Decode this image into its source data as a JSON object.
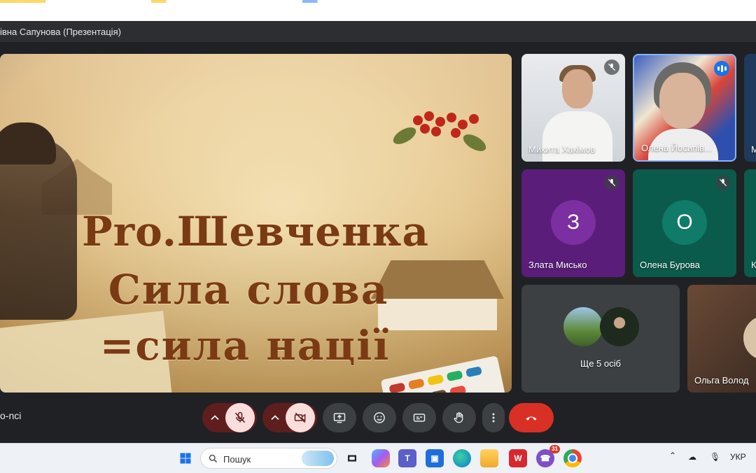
{
  "window": {
    "title": "івна Сапунова (Презентація)"
  },
  "slide": {
    "line1": "Pro.Шевченка",
    "line2": "Сила слова",
    "line3": "=сила нації"
  },
  "participants": [
    {
      "name": "Микита Хакімов",
      "muted": true
    },
    {
      "name": "Олена Йосипів...",
      "speaking": true
    },
    {
      "name": "М"
    },
    {
      "name": "Злата Мисько",
      "initial": "З",
      "muted": true,
      "color": "#6a1b9a"
    },
    {
      "name": "Олена Бурова",
      "initial": "О",
      "muted": true,
      "color": "#00695c"
    },
    {
      "name": "К"
    },
    {
      "name": "Ще 5 осіб"
    },
    {
      "name": "Ольга Волод"
    }
  ],
  "meeting": {
    "code_fragment": "o-nci"
  },
  "taskbar": {
    "search_placeholder": "Пошук",
    "viber_badge": "31",
    "language": "УКР"
  },
  "colors": {
    "end_call": "#d93025",
    "muted_bg": "#f9dedc",
    "speaking": "#1a73e8"
  }
}
